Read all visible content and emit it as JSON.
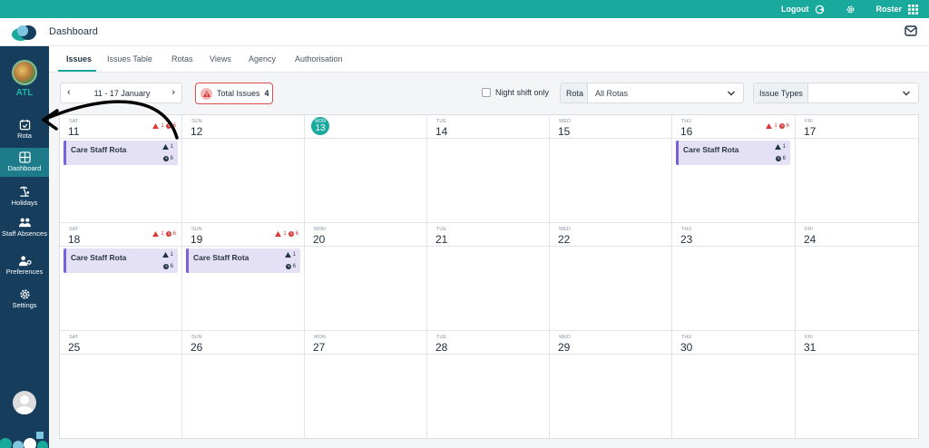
{
  "topbar": {
    "logout_label": "Logout",
    "roster_label": "Roster"
  },
  "header": {
    "title": "Dashboard"
  },
  "sidebar": {
    "org": "ATL",
    "items": [
      {
        "label": "Rota",
        "icon": "calendar-check-icon"
      },
      {
        "label": "Dashboard",
        "icon": "dashboard-icon"
      },
      {
        "label": "Holidays",
        "icon": "beach-icon"
      },
      {
        "label": "Staff Absences",
        "icon": "people-icon"
      },
      {
        "label": "Preferences",
        "icon": "user-settings-icon"
      },
      {
        "label": "Settings",
        "icon": "gear-icon"
      }
    ]
  },
  "tabs": [
    "Issues",
    "Issues Table",
    "Rotas",
    "Views",
    "Agency",
    "Authorisation"
  ],
  "toolbar": {
    "date_range": "11 - 17 January",
    "total_issues_label": "Total Issues",
    "total_issues_count": "4",
    "night_shift_label": "Night shift only",
    "rota_label": "Rota",
    "rota_value": "All Rotas",
    "issue_types_label": "Issue Types"
  },
  "calendar": {
    "weeks": [
      [
        {
          "wd": "SAT",
          "day": "11",
          "warn": "1",
          "clock": "6",
          "shift": {
            "name": "Care Staff Rota",
            "people": "1",
            "hours": "6"
          }
        },
        {
          "wd": "SUN",
          "day": "12"
        },
        {
          "wd": "MON",
          "day": "13",
          "today": true
        },
        {
          "wd": "TUE",
          "day": "14"
        },
        {
          "wd": "WED",
          "day": "15"
        },
        {
          "wd": "THU",
          "day": "16",
          "warn": "1",
          "clock": "6",
          "shift": {
            "name": "Care Staff Rota",
            "people": "1",
            "hours": "6"
          }
        },
        {
          "wd": "FRI",
          "day": "17"
        }
      ],
      [
        {
          "wd": "SAT",
          "day": "18",
          "warn": "1",
          "clock": "6",
          "shift": {
            "name": "Care Staff Rota",
            "people": "1",
            "hours": "6"
          }
        },
        {
          "wd": "SUN",
          "day": "19",
          "warn": "1",
          "clock": "6",
          "shift": {
            "name": "Care Staff Rota",
            "people": "1",
            "hours": "6"
          }
        },
        {
          "wd": "MON",
          "day": "20"
        },
        {
          "wd": "TUE",
          "day": "21"
        },
        {
          "wd": "WED",
          "day": "22"
        },
        {
          "wd": "THU",
          "day": "23"
        },
        {
          "wd": "FRI",
          "day": "24"
        }
      ],
      [
        {
          "wd": "SAT",
          "day": "25"
        },
        {
          "wd": "SUN",
          "day": "26"
        },
        {
          "wd": "MON",
          "day": "27"
        },
        {
          "wd": "TUE",
          "day": "28"
        },
        {
          "wd": "WED",
          "day": "29"
        },
        {
          "wd": "THU",
          "day": "30"
        },
        {
          "wd": "FRI",
          "day": "31"
        }
      ]
    ]
  },
  "colors": {
    "accent": "#1aa99d",
    "sidebar": "#163e5c",
    "alert": "#d93838",
    "shift": "#e4e1f7"
  }
}
